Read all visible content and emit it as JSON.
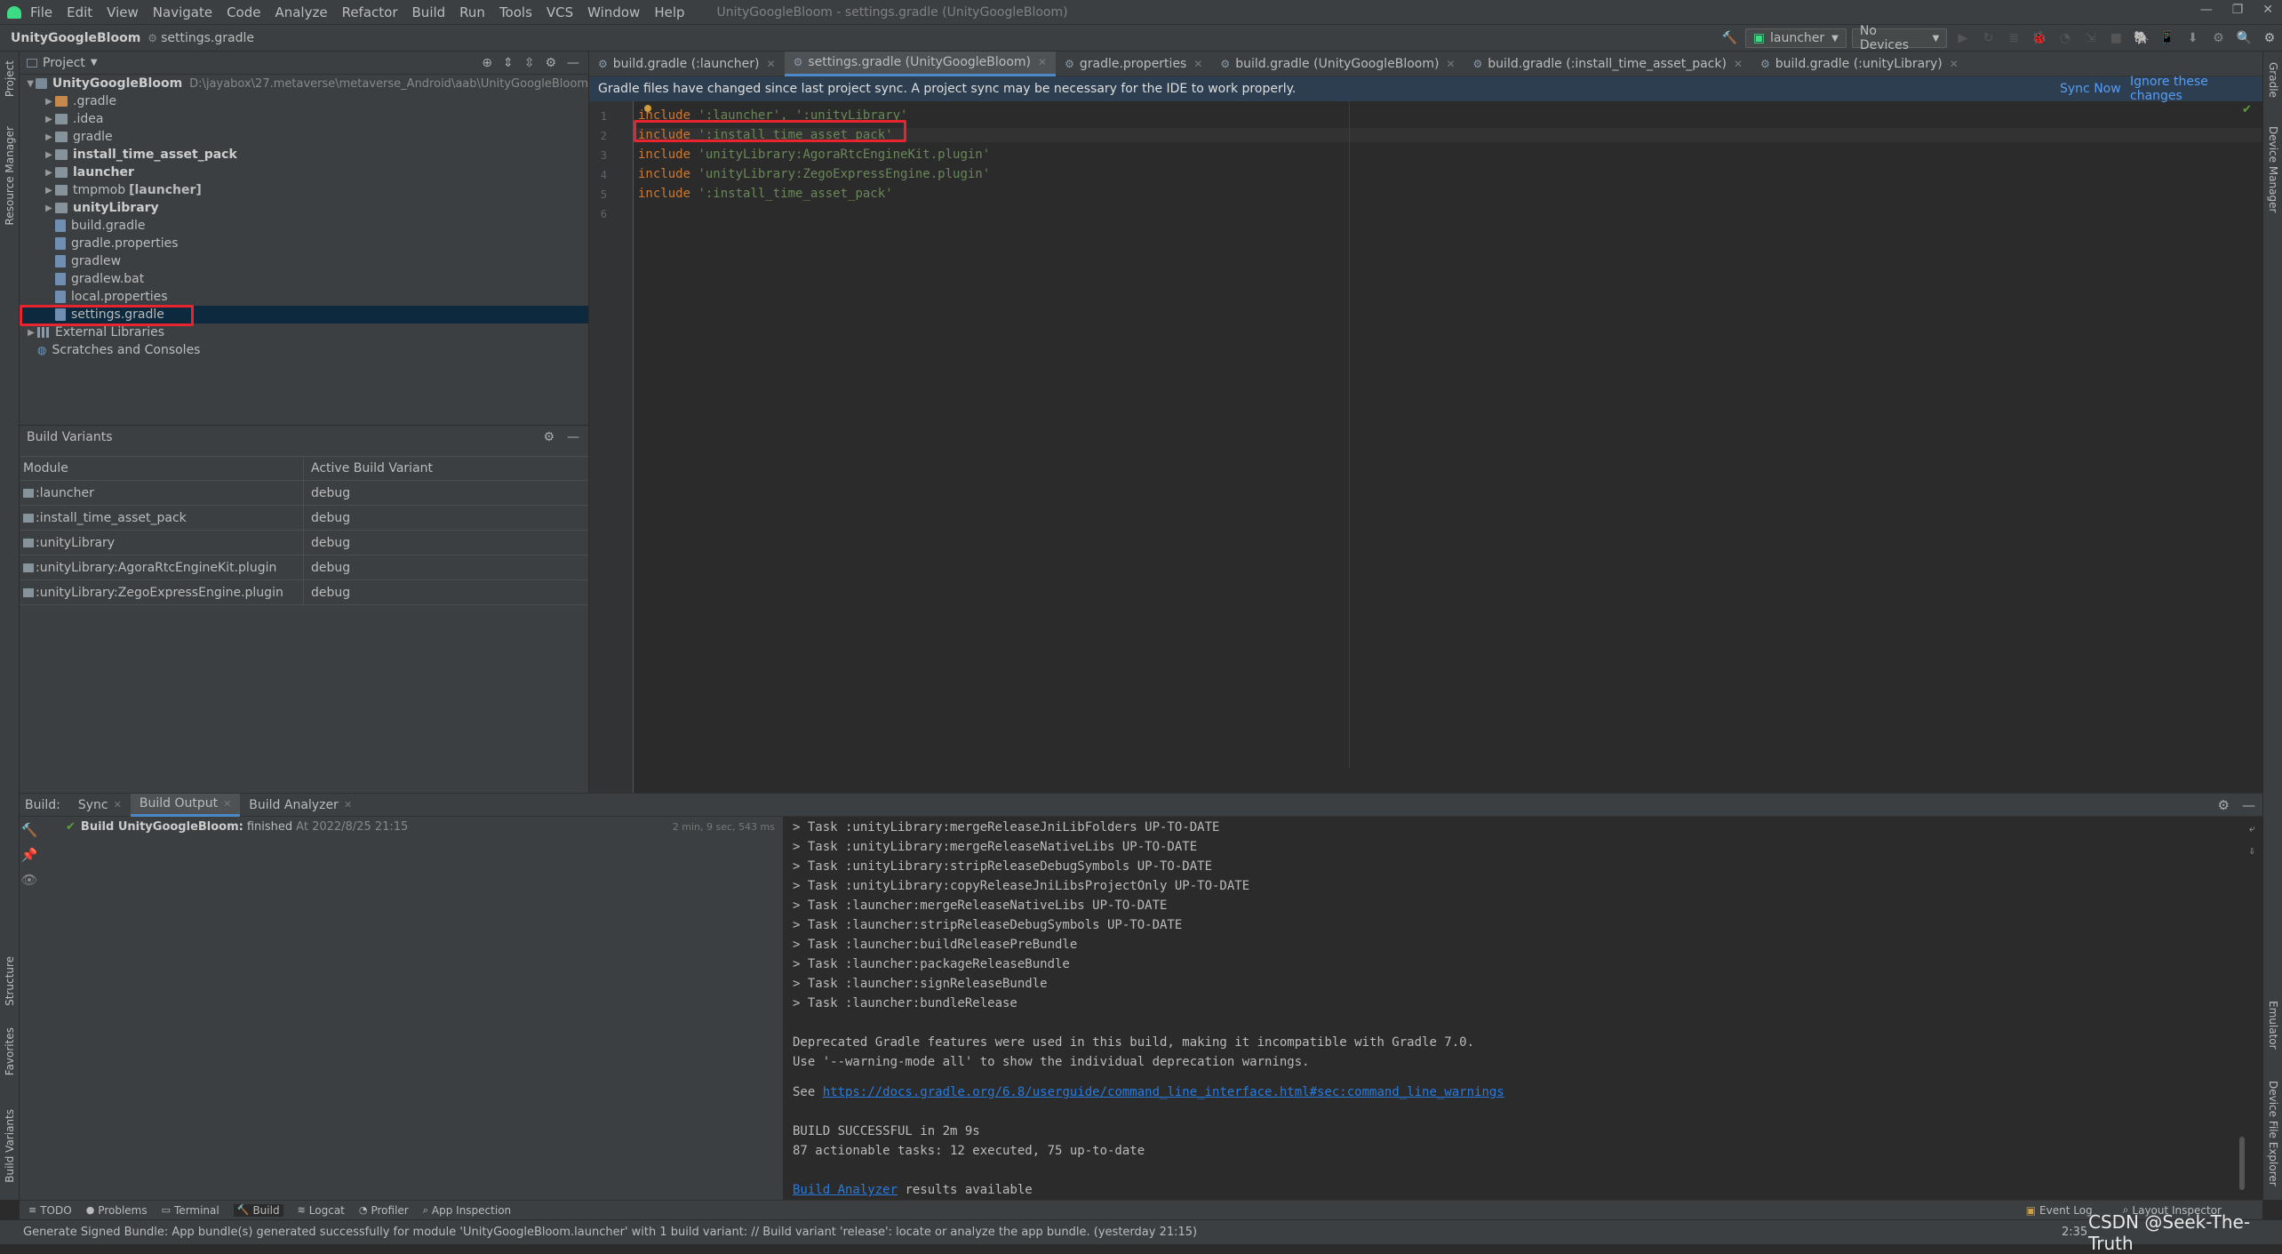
{
  "window": {
    "title": "UnityGoogleBloom - settings.gradle (UnityGoogleBloom)"
  },
  "menu": [
    "File",
    "Edit",
    "View",
    "Navigate",
    "Code",
    "Analyze",
    "Refactor",
    "Build",
    "Run",
    "Tools",
    "VCS",
    "Window",
    "Help"
  ],
  "breadcrumb": {
    "project": "UnityGoogleBloom",
    "file": "settings.gradle"
  },
  "toolbar": {
    "run_config": "launcher",
    "device": "No Devices"
  },
  "project_panel": {
    "header": "Project",
    "root": {
      "name": "UnityGoogleBloom",
      "path": "D:\\jayabox\\27.metaverse\\metaverse_Android\\aab\\UnityGoogleBloom"
    },
    "items": [
      {
        "label": ".gradle",
        "type": "folder",
        "color": "orange",
        "depth": 1,
        "bold": false
      },
      {
        "label": ".idea",
        "type": "folder",
        "depth": 1,
        "bold": false
      },
      {
        "label": "gradle",
        "type": "folder",
        "depth": 1,
        "bold": false
      },
      {
        "label": "install_time_asset_pack",
        "type": "folder",
        "depth": 1,
        "bold": true
      },
      {
        "label": "launcher",
        "type": "folder",
        "depth": 1,
        "bold": true
      },
      {
        "label": "tmpmob",
        "suffix": "[launcher]",
        "type": "folder",
        "depth": 1,
        "bold": false
      },
      {
        "label": "unityLibrary",
        "type": "folder",
        "depth": 1,
        "bold": true
      },
      {
        "label": "build.gradle",
        "type": "file",
        "depth": 1
      },
      {
        "label": "gradle.properties",
        "type": "file",
        "depth": 1
      },
      {
        "label": "gradlew",
        "type": "file",
        "depth": 1
      },
      {
        "label": "gradlew.bat",
        "type": "file",
        "depth": 1
      },
      {
        "label": "local.properties",
        "type": "file",
        "depth": 1
      },
      {
        "label": "settings.gradle",
        "type": "file",
        "depth": 1,
        "selected": true
      }
    ],
    "external_libraries": "External Libraries",
    "scratches": "Scratches and Consoles"
  },
  "build_variants": {
    "title": "Build Variants",
    "col_module": "Module",
    "col_variant": "Active Build Variant",
    "rows": [
      {
        "module": ":launcher",
        "variant": "debug"
      },
      {
        "module": ":install_time_asset_pack",
        "variant": "debug"
      },
      {
        "module": ":unityLibrary",
        "variant": "debug"
      },
      {
        "module": ":unityLibrary:AgoraRtcEngineKit.plugin",
        "variant": "debug"
      },
      {
        "module": ":unityLibrary:ZegoExpressEngine.plugin",
        "variant": "debug"
      }
    ]
  },
  "editor_tabs": [
    {
      "label": "build.gradle (:launcher)",
      "active": false
    },
    {
      "label": "settings.gradle (UnityGoogleBloom)",
      "active": true
    },
    {
      "label": "gradle.properties",
      "active": false
    },
    {
      "label": "build.gradle (UnityGoogleBloom)",
      "active": false
    },
    {
      "label": "build.gradle (:install_time_asset_pack)",
      "active": false
    },
    {
      "label": "build.gradle (:unityLibrary)",
      "active": false
    }
  ],
  "banner": {
    "message": "Gradle files have changed since last project sync. A project sync may be necessary for the IDE to work properly.",
    "sync_now": "Sync Now",
    "ignore": "Ignore these changes"
  },
  "code": [
    {
      "n": "1",
      "kw": "include",
      "rest": " ':launcher', ':unityLibrary'"
    },
    {
      "n": "2",
      "kw": "include",
      "rest": " ':install_time_asset_pack'"
    },
    {
      "n": "3",
      "kw": "include",
      "rest": " 'unityLibrary:AgoraRtcEngineKit.plugin'"
    },
    {
      "n": "4",
      "kw": "include",
      "rest": " 'unityLibrary:ZegoExpressEngine.plugin'"
    },
    {
      "n": "5",
      "kw": "include",
      "rest": " ':install_time_asset_pack'"
    },
    {
      "n": "6",
      "kw": "",
      "rest": ""
    }
  ],
  "build_panel": {
    "label": "Build:",
    "tabs": [
      "Sync",
      "Build Output",
      "Build Analyzer"
    ],
    "result": {
      "name": "Build UnityGoogleBloom:",
      "status": "finished",
      "at": "At 2022/8/25 21:15",
      "duration": "2 min, 9 sec, 543 ms"
    },
    "output": [
      "> Task :unityLibrary:mergeReleaseJniLibFolders UP-TO-DATE",
      "> Task :unityLibrary:mergeReleaseNativeLibs UP-TO-DATE",
      "> Task :unityLibrary:stripReleaseDebugSymbols UP-TO-DATE",
      "> Task :unityLibrary:copyReleaseJniLibsProjectOnly UP-TO-DATE",
      "> Task :launcher:mergeReleaseNativeLibs UP-TO-DATE",
      "> Task :launcher:stripReleaseDebugSymbols UP-TO-DATE",
      "> Task :launcher:buildReleasePreBundle",
      "> Task :launcher:packageReleaseBundle",
      "> Task :launcher:signReleaseBundle",
      "> Task :launcher:bundleRelease",
      "",
      "Deprecated Gradle features were used in this build, making it incompatible with Gradle 7.0.",
      "Use '--warning-mode all' to show the individual deprecation warnings."
    ],
    "see_prefix": "See ",
    "see_link": "https://docs.gradle.org/6.8/userguide/command_line_interface.html#sec:command_line_warnings",
    "success": "BUILD SUCCESSFUL in 2m 9s",
    "tasks": "87 actionable tasks: 12 executed, 75 up-to-date",
    "analyzer_link": "Build Analyzer",
    "analyzer_suffix": " results available"
  },
  "tool_windows": [
    "TODO",
    "Problems",
    "Terminal",
    "Build",
    "Logcat",
    "Profiler",
    "App Inspection"
  ],
  "tool_windows_right": [
    "Event Log",
    "Layout Inspector"
  ],
  "left_strip": [
    "Project",
    "Resource Manager",
    "Structure",
    "Favorites",
    "Build Variants"
  ],
  "right_strip": [
    "Gradle",
    "Device Manager",
    "Emulator",
    "Device File Explorer"
  ],
  "status": {
    "message": "Generate Signed Bundle: App bundle(s) generated successfully for module 'UnityGoogleBloom.launcher' with 1 build variant: // Build variant 'release': locate or analyze the app bundle. (yesterday 21:15)",
    "position": "2:35",
    "watermark": "CSDN @Seek-The-Truth"
  }
}
